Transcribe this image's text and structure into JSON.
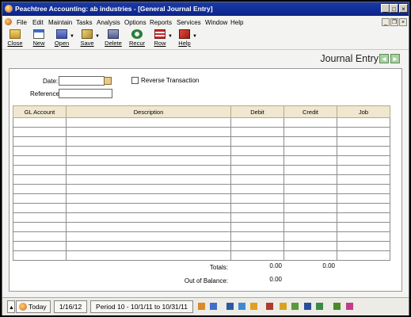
{
  "window": {
    "title": "Peachtree Accounting: ab industries - [General Journal Entry]"
  },
  "menu": [
    "File",
    "Edit",
    "Maintain",
    "Tasks",
    "Analysis",
    "Options",
    "Reports",
    "Services",
    "Window",
    "Help"
  ],
  "toolbar": [
    {
      "label": "Close",
      "icon": "close-folder-icon"
    },
    {
      "label": "New",
      "icon": "new-document-icon"
    },
    {
      "label": "Open",
      "icon": "open-folder-icon"
    },
    {
      "label": "Save",
      "icon": "save-icon"
    },
    {
      "label": "Delete",
      "icon": "delete-icon"
    },
    {
      "label": "Recur",
      "icon": "recur-icon"
    },
    {
      "label": "Row",
      "icon": "row-icon"
    },
    {
      "label": "Help",
      "icon": "help-book-icon"
    }
  ],
  "header": {
    "title": "Journal Entry"
  },
  "form": {
    "date_label": "Date:",
    "date_value": "",
    "reference_label": "Reference:",
    "reference_value": "",
    "reverse_label": "Reverse Transaction",
    "reverse_checked": false
  },
  "grid": {
    "columns": [
      "GL Account",
      "Description",
      "Debit",
      "Credit",
      "Job"
    ],
    "row_count": 15
  },
  "totals": {
    "totals_label": "Totals:",
    "debit_total": "0.00",
    "credit_total": "0.00",
    "out_of_balance_label": "Out of Balance:",
    "out_of_balance": "0.00"
  },
  "status": {
    "today_label": "Today",
    "date": "1/16/12",
    "period": "Period 10 - 10/1/11 to 10/31/11"
  },
  "colors": {
    "title_bar": "#0b248a",
    "grid_header": "#efe7cf",
    "nav_button": "#a9d0a0"
  }
}
